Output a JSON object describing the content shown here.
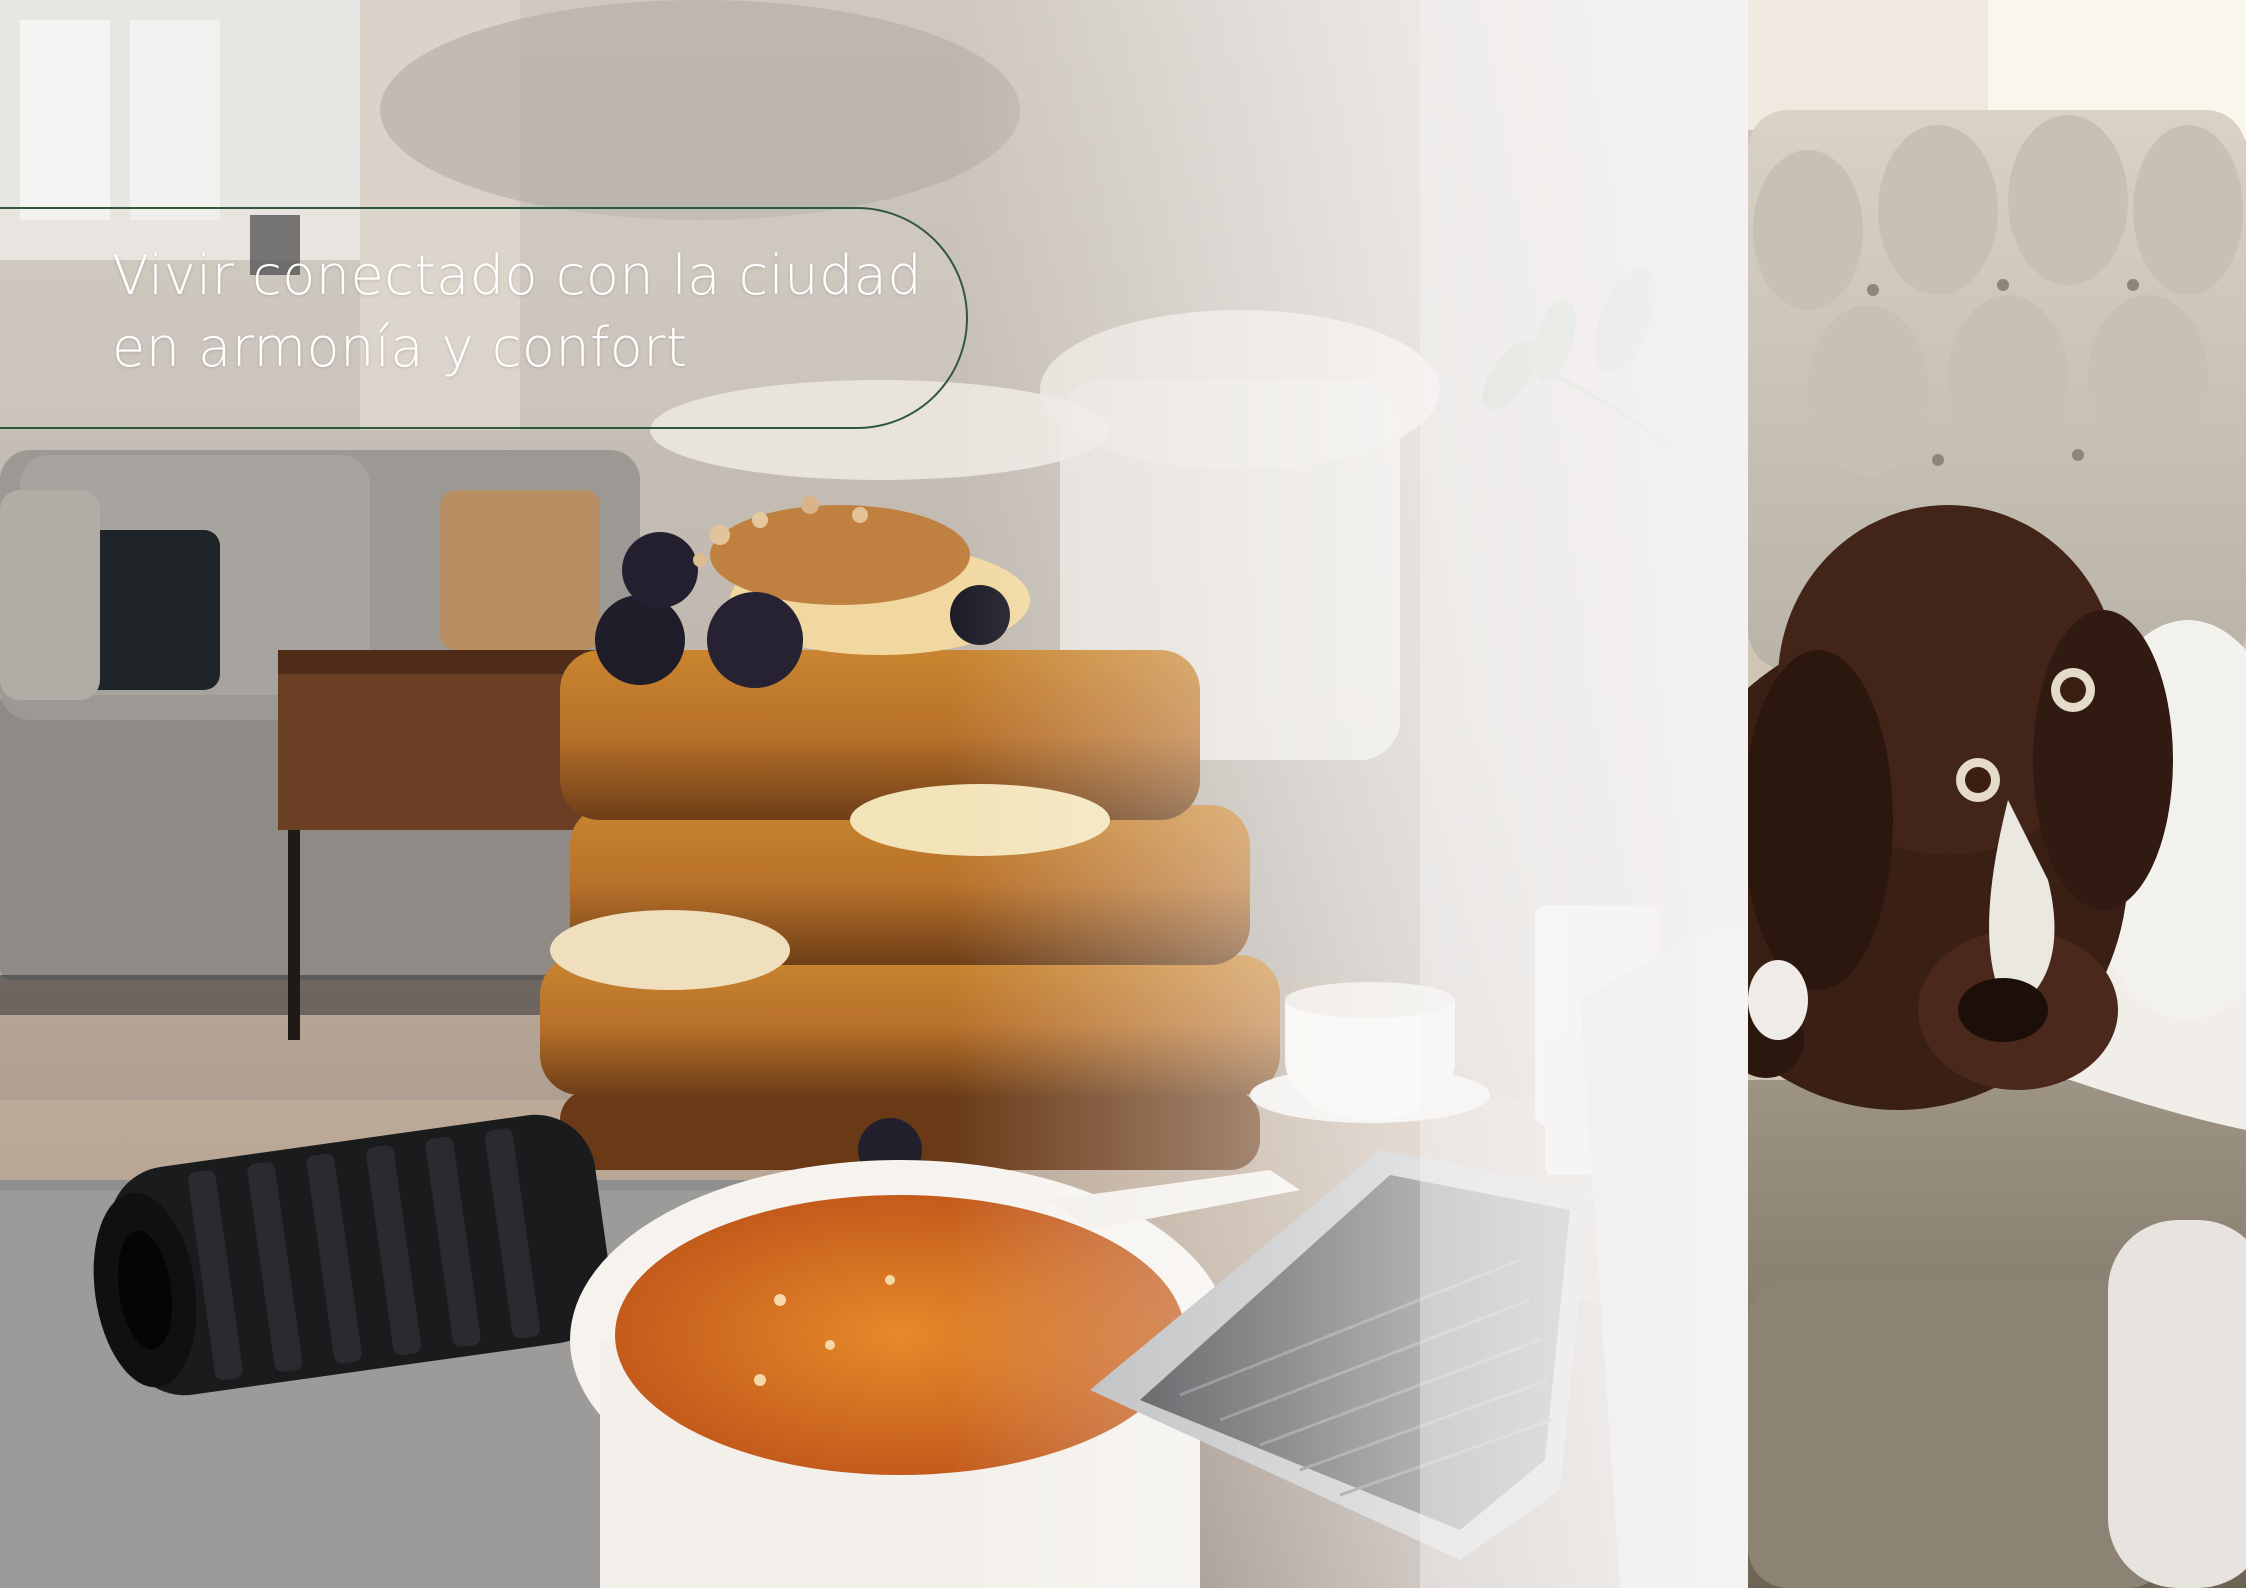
{
  "tagline": {
    "line1": "Vivir conectado con la ciudad",
    "line2": "en armonía y confort"
  },
  "colors": {
    "accent_green": "#2f5a3a",
    "tagline_text": "#ffffff"
  },
  "images": {
    "collage": "living room with sofa, french toast stack with banana and blueberries, cups of coffee, foam roller, laptop and jam bowl",
    "right_panel": "brown and white spaniel puppy resting on a tufted sofa"
  }
}
